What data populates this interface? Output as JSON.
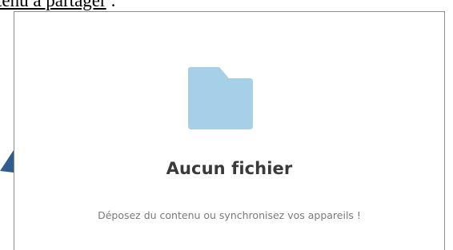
{
  "document": {
    "heading_link": "tenu à partager",
    "heading_suffix": " :"
  },
  "file_panel": {
    "empty_title": "Aucun fichier",
    "empty_subtitle": "Déposez du contenu ou synchronisez vos appareils !",
    "folder_color": "#a6d0e8"
  },
  "annotation": {
    "arrow_color": "#2f5d8f"
  }
}
